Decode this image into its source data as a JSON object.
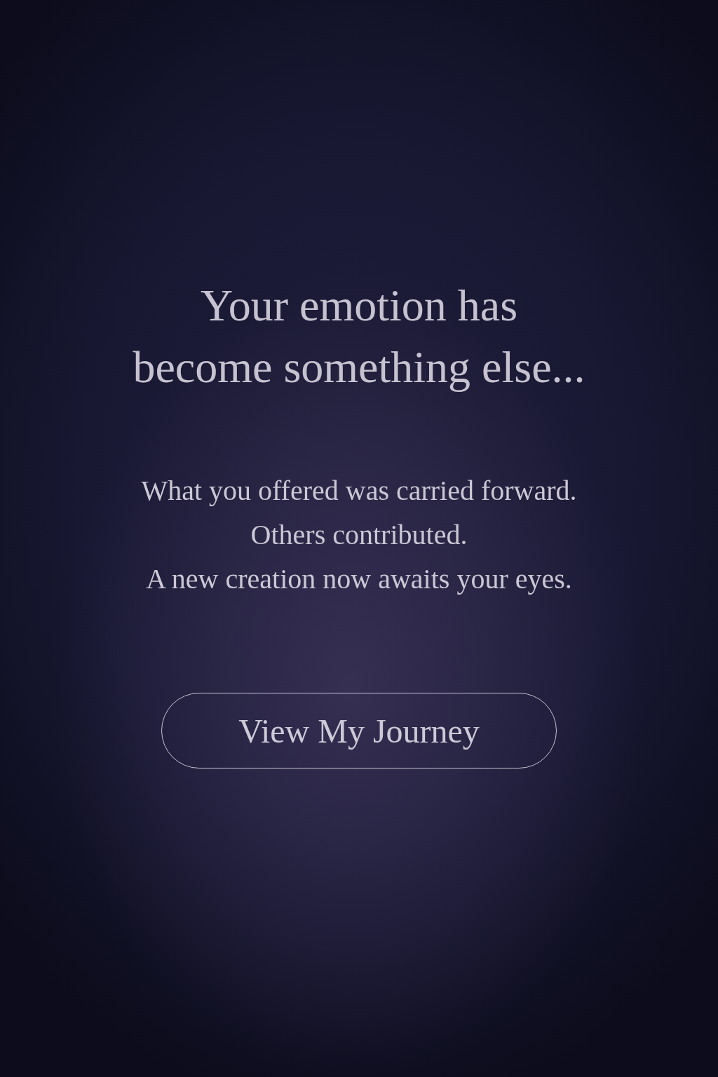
{
  "title": "Your emotion has\nbecome something else...",
  "message_lines": [
    "What you offered was carried forward.",
    "Others contributed.",
    "A new creation now awaits your eyes."
  ],
  "button": {
    "label": "View My Journey"
  }
}
